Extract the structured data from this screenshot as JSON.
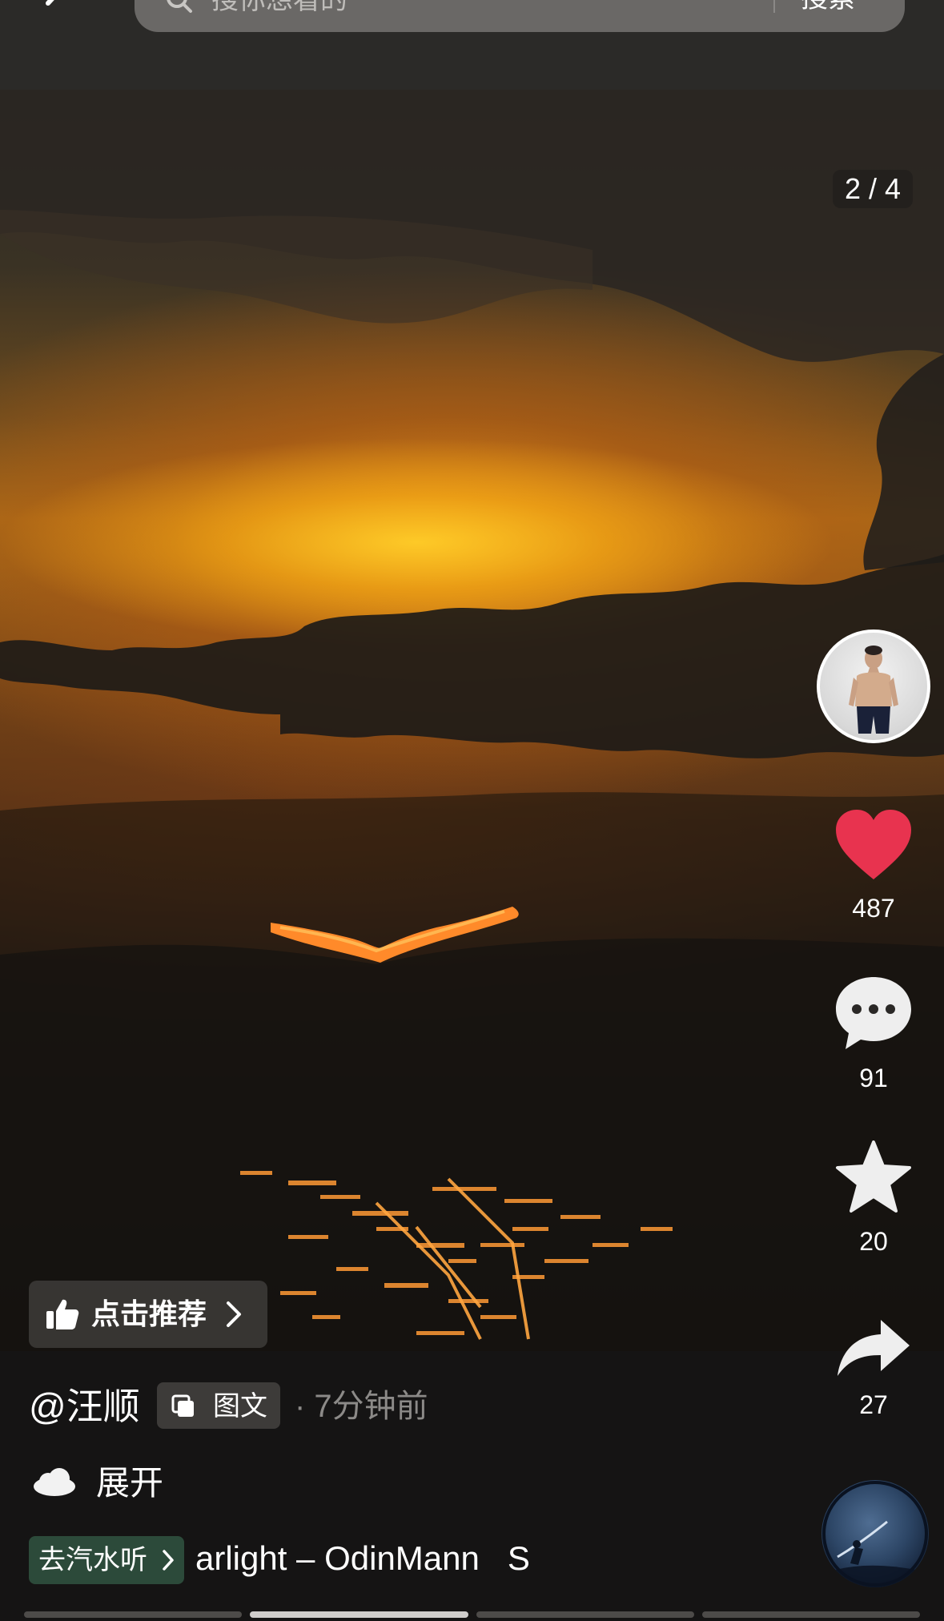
{
  "search": {
    "placeholder": "搜你想看的",
    "submit_label": "搜索"
  },
  "photo": {
    "page_indicator": "2 / 4",
    "current_page": 2,
    "total_pages": 4
  },
  "actions": {
    "likes": "487",
    "comments": "91",
    "favorites": "20",
    "shares": "27",
    "like_color": "#e8334f"
  },
  "recommend": {
    "label": "点击推荐"
  },
  "post": {
    "author": "@汪顺",
    "type_label": "图文",
    "time": "· 7分钟前",
    "expand_label": "展开"
  },
  "music": {
    "button_label": "去汽水听",
    "ticker": "arlight – OdinMann   S"
  },
  "icons": {
    "back": "back-arrow-icon",
    "search": "search-icon",
    "like": "heart-icon",
    "comment": "comment-bubble-icon",
    "favorite": "star-icon",
    "share": "share-arrow-icon",
    "recommend": "thumbs-up-icon",
    "weather": "cloud-icon"
  }
}
